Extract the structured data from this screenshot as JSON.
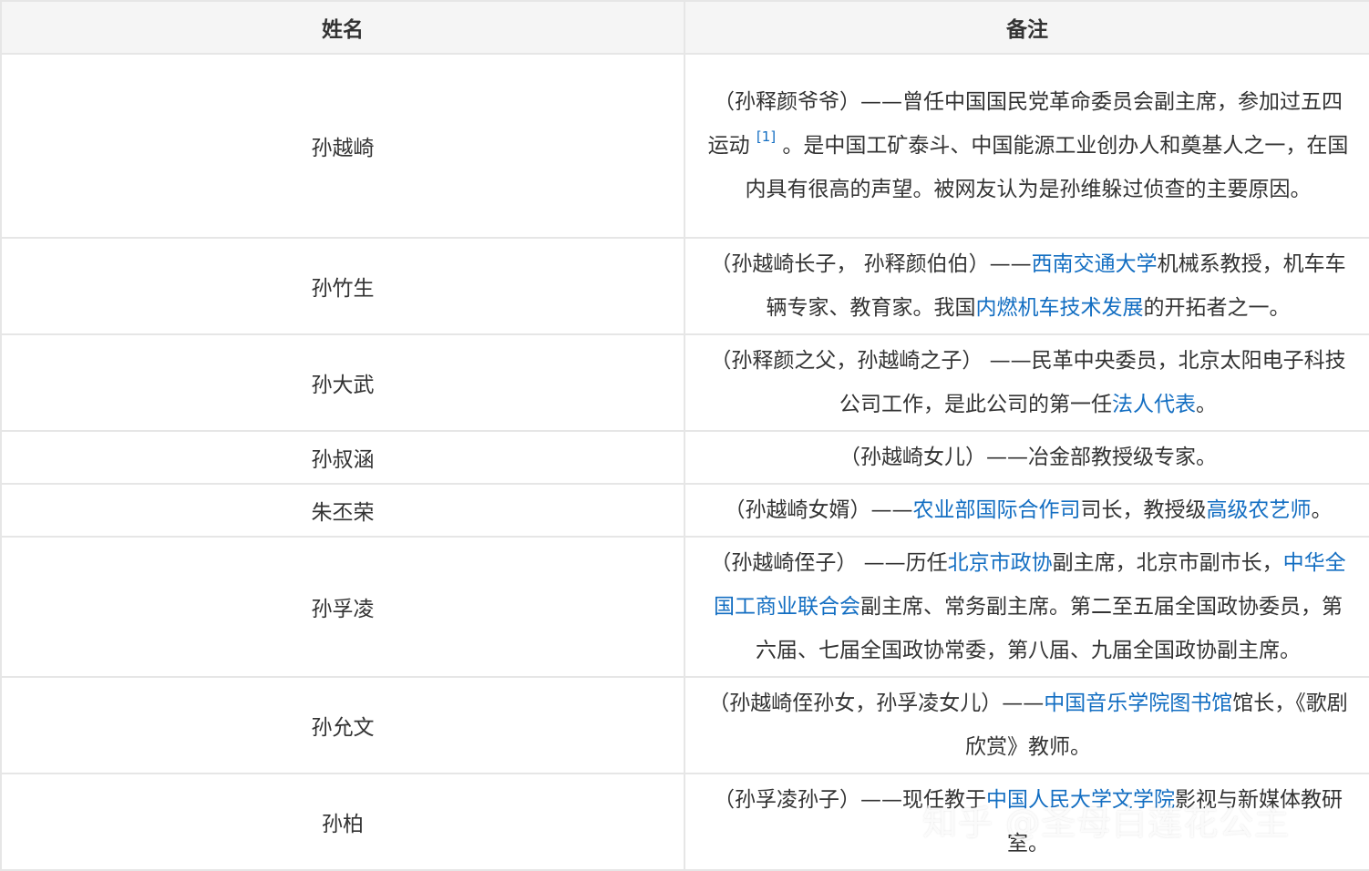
{
  "header": {
    "name_col": "姓名",
    "note_col": "备注"
  },
  "rows": [
    {
      "name": "孙越崎",
      "note": [
        {
          "t": "（孙释颜爷爷）——曾任中国国民党革命委员会副主席，参加过五四运动 "
        },
        {
          "t": "[1]",
          "sup": true
        },
        {
          "t": " 。是中国工矿泰斗、中国能源工业创办人和奠基人之一，在国内具有很高的声望。被网友认为是孙维躲过侦查的主要原因。"
        }
      ]
    },
    {
      "name": "孙竹生",
      "note": [
        {
          "t": "（孙越崎长子， 孙释颜伯伯）——"
        },
        {
          "t": "西南交通大学",
          "link": true
        },
        {
          "t": "机械系教授，机车车辆专家、教育家。我国"
        },
        {
          "t": "内燃机车技术发展",
          "link": true
        },
        {
          "t": "的开拓者之一。"
        }
      ]
    },
    {
      "name": "孙大武",
      "note": [
        {
          "t": "（孙释颜之父，孙越崎之子） ——民革中央委员，北京太阳电子科技公司工作，是此公司的第一任"
        },
        {
          "t": "法人代表",
          "link": true
        },
        {
          "t": "。"
        }
      ]
    },
    {
      "name": "孙叔涵",
      "note": [
        {
          "t": "（孙越崎女儿）——冶金部教授级专家。"
        }
      ]
    },
    {
      "name": "朱丕荣",
      "note": [
        {
          "t": "（孙越崎女婿）——"
        },
        {
          "t": "农业部国际合作司",
          "link": true
        },
        {
          "t": "司长，教授级"
        },
        {
          "t": "高级农艺师",
          "link": true
        },
        {
          "t": "。"
        }
      ]
    },
    {
      "name": "孙孚凌",
      "note": [
        {
          "t": "（孙越崎侄子） ——历任"
        },
        {
          "t": "北京市政协",
          "link": true
        },
        {
          "t": "副主席，北京市副市长，"
        },
        {
          "t": "中华全国工商业联合会",
          "link": true
        },
        {
          "t": "副主席、常务副主席。第二至五届全国政协委员，第六届、七届全国政协常委，第八届、九届全国政协副主席。"
        }
      ]
    },
    {
      "name": "孙允文",
      "note": [
        {
          "t": "（孙越崎侄孙女，孙孚凌女儿）——"
        },
        {
          "t": "中国音乐学院图书馆",
          "link": true
        },
        {
          "t": "馆长，《歌剧欣赏》教师。"
        }
      ]
    },
    {
      "name": "孙柏",
      "note": [
        {
          "t": "（孙孚凌孙子）——现任教于"
        },
        {
          "t": "中国人民大学文学院",
          "link": true
        },
        {
          "t": "影视与新媒体教研室。"
        }
      ]
    }
  ],
  "watermark": "知乎 @圣母白莲花公主"
}
